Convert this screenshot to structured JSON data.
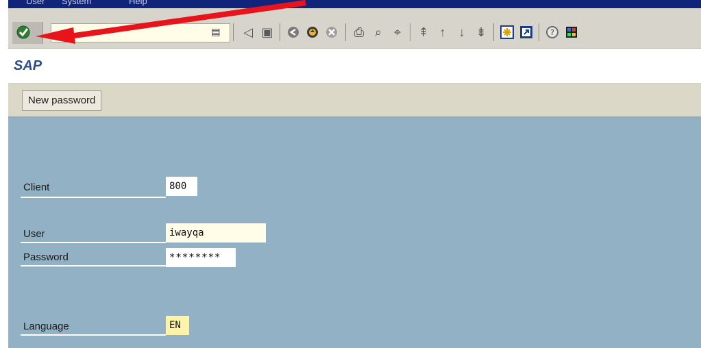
{
  "menu": {
    "items": [
      "User",
      "System",
      "Help"
    ]
  },
  "toolbar": {
    "enter_icon": "green-check-icon",
    "command_field_value": "",
    "command_dropdown_icon": "list-icon",
    "icons": [
      "back-icon",
      "save-icon",
      "back-nav-icon",
      "exit-icon",
      "cancel-icon",
      "print-icon",
      "find-icon",
      "find-next-icon",
      "first-page-icon",
      "previous-page-icon",
      "next-page-icon",
      "last-page-icon",
      "new-session-icon",
      "shortcut-icon",
      "help-icon",
      "layout-menu-icon"
    ]
  },
  "title": "SAP",
  "app_toolbar": {
    "new_password_label": "New password"
  },
  "form": {
    "client_label": "Client",
    "client_value": "800",
    "user_label": "User",
    "user_value": "iwayqa",
    "password_label": "Password",
    "password_value": "********",
    "language_label": "Language",
    "language_value": "EN"
  },
  "colors": {
    "menu_bar": "#10247a",
    "toolbar": "#d7d4cb",
    "title_text": "#304b8c",
    "app_toolbar": "#dcd8c8",
    "main_background": "#92b1c4",
    "arrow": "#e8141c"
  }
}
